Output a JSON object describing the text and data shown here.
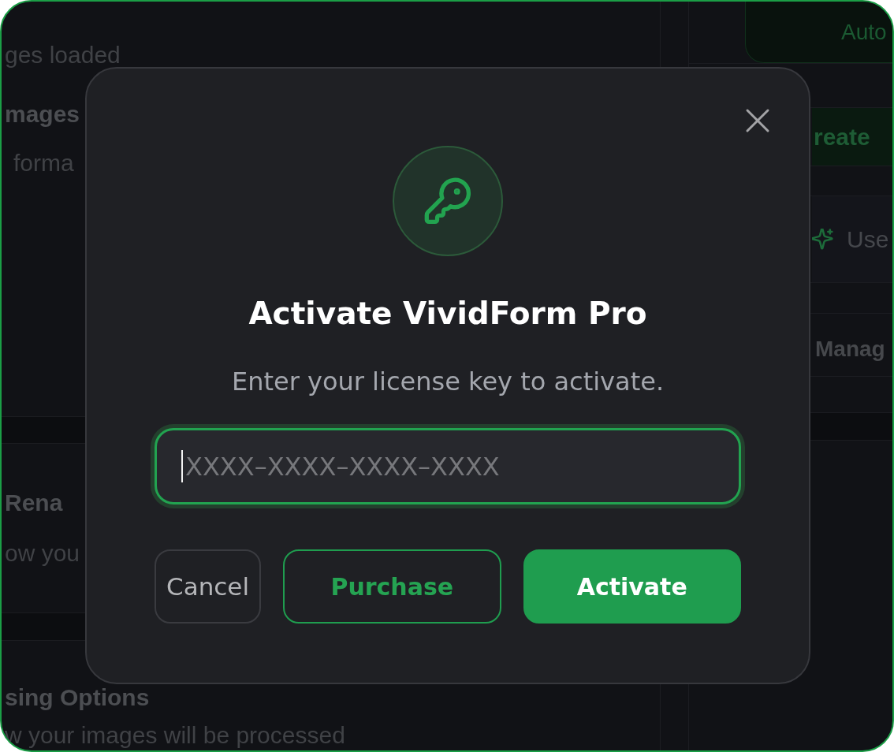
{
  "background": {
    "status_text": "ges loaded",
    "sections": [
      {
        "title": "mages",
        "description": "forma"
      },
      {
        "title": "Rena",
        "description": "ow you"
      },
      {
        "title": "sing Options",
        "description": "w your images will be processed"
      }
    ],
    "side_panel": {
      "auto_card": "Auto",
      "create_button": "reate",
      "items": [
        {
          "kind": "ai",
          "label": "Use"
        },
        {
          "kind": "heading",
          "label": "Manag"
        }
      ]
    }
  },
  "dialog": {
    "title": "Activate VividForm Pro",
    "subtitle": "Enter your license key to activate.",
    "license_field": {
      "placeholder": "XXXX–XXXX–XXXX–XXXX",
      "focused": true
    },
    "buttons": [
      {
        "kind": "secondary",
        "label": "Cancel"
      },
      {
        "kind": "outline",
        "label": "Purchase"
      },
      {
        "kind": "primary",
        "label": "Activate"
      }
    ]
  }
}
